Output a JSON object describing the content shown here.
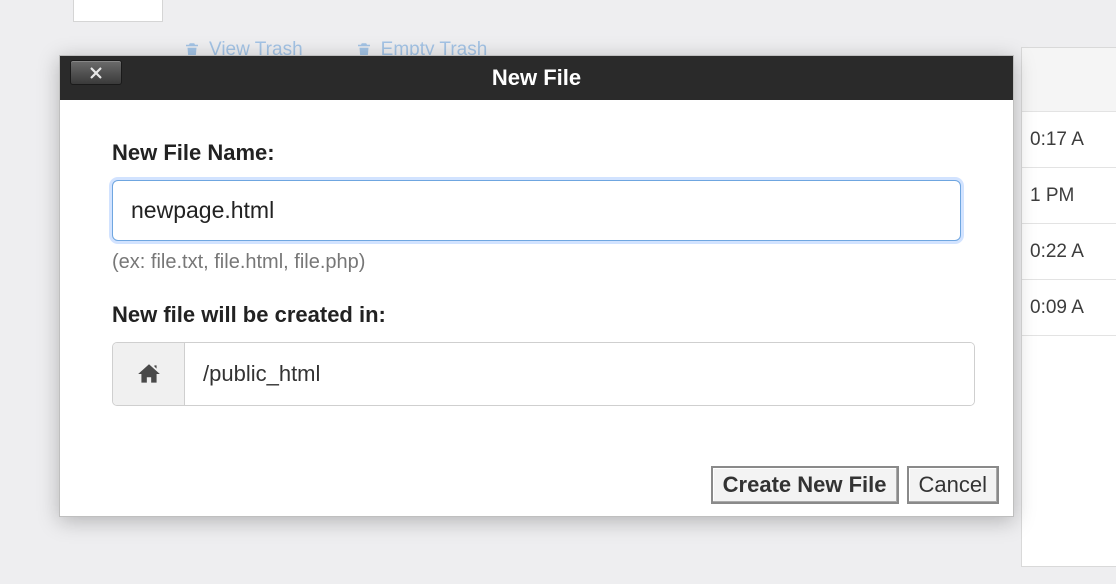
{
  "background": {
    "trash_links": [
      "View Trash",
      "Empty Trash"
    ],
    "timestamps": [
      "0:17 A",
      "1 PM",
      "0:22 A",
      "0:09 A"
    ]
  },
  "dialog": {
    "title": "New File",
    "filename_label": "New File Name:",
    "filename_value": "newpage.html",
    "filename_hint": "(ex: file.txt, file.html, file.php)",
    "location_label": "New file will be created in:",
    "location_path": "/public_html",
    "buttons": {
      "create": "Create New File",
      "cancel": "Cancel"
    }
  }
}
